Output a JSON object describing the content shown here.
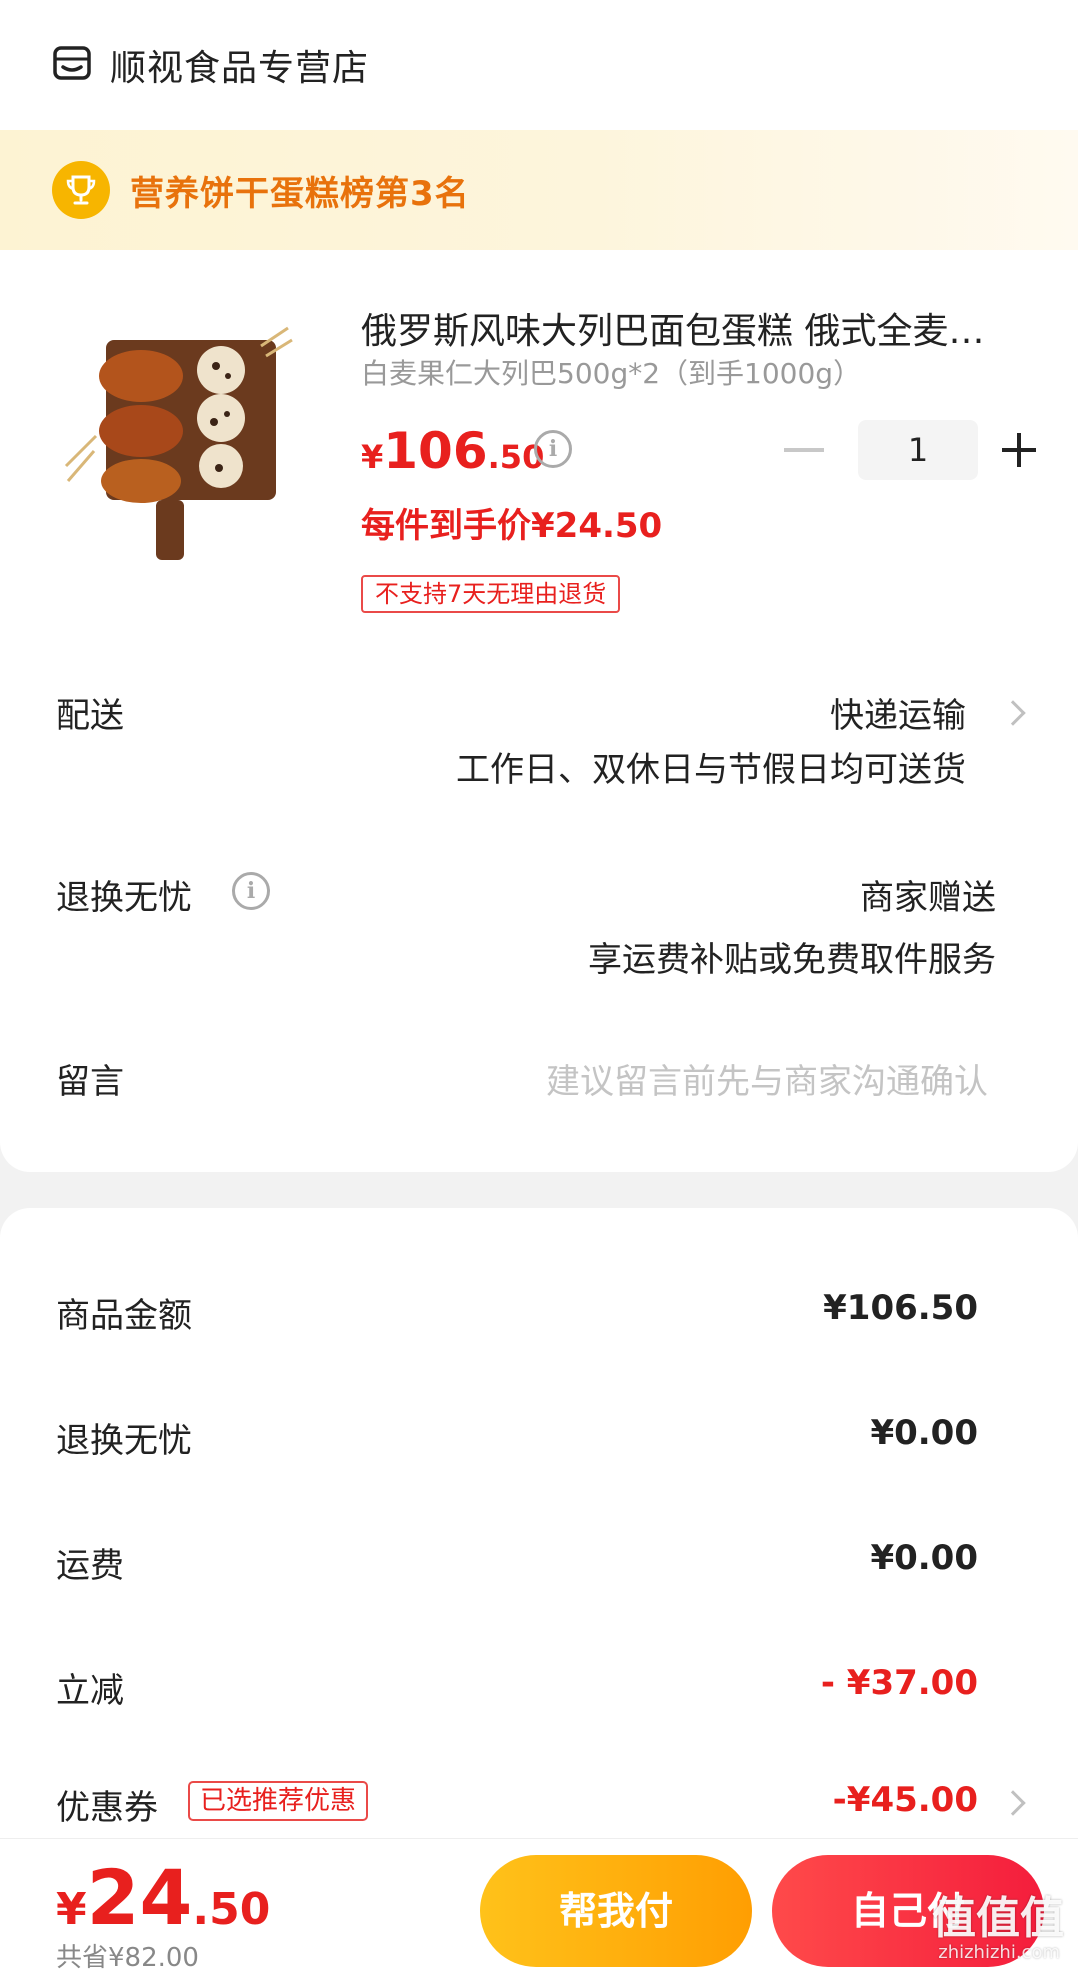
{
  "store": {
    "name": "顺视食品专营店",
    "icon": "store-icon"
  },
  "rank": {
    "text": "营养饼干蛋糕榜第3名",
    "icon": "trophy-icon"
  },
  "product": {
    "title": "俄罗斯风味大列巴面包蛋糕 俄式全麦果仁",
    "spec": "白麦果仁大列巴500g*2（到手1000g）",
    "price_currency": "¥",
    "price_int": "106",
    "price_dec": ".50",
    "unit_price": "每件到手价¥24.50",
    "quantity": "1",
    "tag": "不支持7天无理由退货"
  },
  "delivery": {
    "label": "配送",
    "method": "快递运输",
    "note": "工作日、双休日与节假日均可送货"
  },
  "returns": {
    "label": "退换无忧",
    "provider": "商家赠送",
    "note": "享运费补贴或免费取件服务"
  },
  "message": {
    "label": "留言",
    "placeholder": "建议留言前先与商家沟通确认"
  },
  "fees": [
    {
      "label": "商品金额",
      "value": "¥106.50",
      "red": false
    },
    {
      "label": "退换无忧",
      "value": "¥0.00",
      "red": false
    },
    {
      "label": "运费",
      "value": "¥0.00",
      "red": false
    },
    {
      "label": "立减",
      "value": "- ¥37.00",
      "red": true
    },
    {
      "label": "优惠券",
      "value": "-¥45.00",
      "red": true
    }
  ],
  "coupon_tag": "已选推荐优惠",
  "bottom": {
    "total_currency": "¥",
    "total_int": "24",
    "total_dec": ".50",
    "saved": "共省¥82.00",
    "help_pay": "帮我付",
    "self_pay": "自己付"
  },
  "watermark": {
    "text": "值值值",
    "url": "zhizhizhi.com"
  },
  "colors": {
    "accent_red": "#e8201e",
    "accent_orange": "#e8720c",
    "help_btn": "#ffb20e",
    "self_btn": "#f7303f"
  }
}
